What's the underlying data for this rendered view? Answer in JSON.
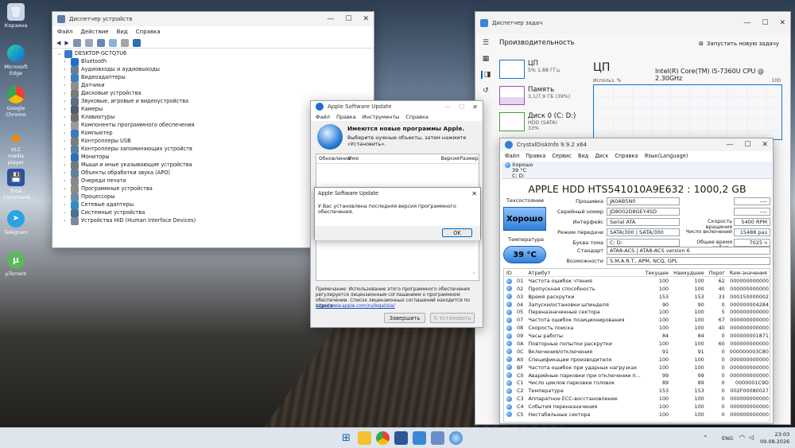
{
  "desktop_icons": [
    {
      "label": "Корзина",
      "icon": "recycle-bin-icon"
    },
    {
      "label": "Microsoft Edge",
      "icon": "edge-icon"
    },
    {
      "label": "Google Chrome",
      "icon": "chrome-icon"
    },
    {
      "label": "VLC media player",
      "icon": "vlc-icon"
    },
    {
      "label": "Total Command...",
      "icon": "total-commander-icon"
    },
    {
      "label": "Telegram",
      "icon": "telegram-icon"
    },
    {
      "label": "µTorrent",
      "icon": "utorrent-icon"
    }
  ],
  "device_manager": {
    "title": "Диспетчер устройств",
    "menu": [
      "Файл",
      "Действие",
      "Вид",
      "Справка"
    ],
    "root": "DESKTOP-GC7Q7U6",
    "items": [
      "Bluetooth",
      "Аудиовходы и аудиовыходы",
      "Видеоадаптеры",
      "Датчики",
      "Дисковые устройства",
      "Звуковые, игровые и видеоустройства",
      "Камеры",
      "Клавиатуры",
      "Компоненты программного обеспечения",
      "Компьютер",
      "Контроллеры USB",
      "Контроллеры запоминающих устройств",
      "Мониторы",
      "Мыши и иные указывающие устройства",
      "Объекты обработки звука (APO)",
      "Очереди печати",
      "Программные устройства",
      "Процессоры",
      "Сетевые адаптеры",
      "Системные устройства",
      "Устройства HID (Human Interface Devices)"
    ]
  },
  "task_manager": {
    "title": "Диспетчер задач",
    "header": "Производительность",
    "run_task": "Запустить новую задачу",
    "cards": [
      {
        "name": "ЦП",
        "detail": "5% 1,88 ГГц"
      },
      {
        "name": "Память",
        "detail": "3,1/7,9 ГБ (39%)"
      },
      {
        "name": "Диск 0 (C: D:)",
        "detail": "HDD (SATA)",
        "detail2": "33%"
      }
    ],
    "cpu_title": "ЦП",
    "cpu_model": "Intel(R) Core(TM) i5-7360U CPU @ 2.30GHz",
    "usage_label": "Использ. %",
    "usage_max": "100"
  },
  "apple_update": {
    "title": "Apple Software Update",
    "menu": [
      "Файл",
      "Правка",
      "Инструменты",
      "Справка"
    ],
    "heading": "Имеются новые программы Apple.",
    "subtext": "Выберите нужные объекты, затем нажмите «Установить».",
    "columns": [
      "Обновления",
      "Имя",
      "Версия",
      "Размер"
    ],
    "note": "Примечание: Использование этого программного обеспечения регулируется лицензионным соглашением о программном обеспечении. Список лицензионных соглашений находится по адресу:",
    "link": "http://www.apple.com/ru/legal/sla/",
    "finish_button": "Завершить",
    "install_button": "Установить",
    "dialog": {
      "title": "Apple Software Update",
      "message": "У Вас установлена последняя версия программного обеспечения.",
      "ok": "OK"
    }
  },
  "crystal": {
    "title": "CrystalDiskInfo 9.9.2 x64",
    "menu": [
      "Файл",
      "Правка",
      "Сервис",
      "Вид",
      "Диск",
      "Справка",
      "Язык(Language)"
    ],
    "tab_status": "Хорошо",
    "tab_temp": "39 °C",
    "tab_drive": "C: D:",
    "model": "APPLE HDD HTS541010A9E632 : 1000,2 GB",
    "health_label": "Техсостояние",
    "health_value": "Хорошо",
    "temp_label": "Температура",
    "temp_value": "39 °C",
    "fields_left": [
      {
        "label": "Прошивка",
        "value": "JA0AB5N0"
      },
      {
        "label": "Серийный номер",
        "value": "JD8002D8GEY4SD"
      },
      {
        "label": "Интерфейс",
        "value": "Serial ATA"
      },
      {
        "label": "Режим передачи",
        "value": "SATA/300 | SATA/300"
      },
      {
        "label": "Буква тома",
        "value": "C: D:"
      }
    ],
    "fields_right": [
      {
        "label": "",
        "value": "----"
      },
      {
        "label": "",
        "value": "----"
      },
      {
        "label": "Скорость вращения",
        "value": "5400 RPM"
      },
      {
        "label": "Число включений",
        "value": "15488 раз"
      },
      {
        "label": "Общее время работы",
        "value": "7025 ч"
      }
    ],
    "standard_label": "Стандарт",
    "standard_value": "ATA8-ACS | ATA8-ACS version 6",
    "features_label": "Возможности",
    "features_value": "S.M.A.R.T., APM, NCQ, GPL",
    "smart_headers": [
      "ID",
      "Атрибут",
      "Текущее",
      "Наихудшее",
      "Порог",
      "Raw-значения"
    ],
    "smart": [
      [
        "01",
        "Частота ошибок чтения",
        "100",
        "100",
        "62",
        "000000000000"
      ],
      [
        "02",
        "Пропускная способность",
        "100",
        "100",
        "40",
        "000000000000"
      ],
      [
        "03",
        "Время раскрутки",
        "153",
        "153",
        "33",
        "000150000002"
      ],
      [
        "04",
        "Запуски/остановки шпинделя",
        "90",
        "90",
        "0",
        "000000004284"
      ],
      [
        "05",
        "Переназначенные сектора",
        "100",
        "100",
        "5",
        "000000000000"
      ],
      [
        "07",
        "Частота ошибок позиционирования",
        "100",
        "100",
        "67",
        "000000000000"
      ],
      [
        "08",
        "Скорость поиска",
        "100",
        "100",
        "40",
        "000000000000"
      ],
      [
        "09",
        "Часы работы",
        "84",
        "84",
        "0",
        "000000001871"
      ],
      [
        "0A",
        "Повторные попытки раскрутки",
        "100",
        "100",
        "60",
        "000000000000"
      ],
      [
        "0C",
        "Включения/отключения",
        "91",
        "91",
        "0",
        "000000003C80"
      ],
      [
        "A0",
        "Спецификации производителя",
        "100",
        "100",
        "0",
        "000000000000"
      ],
      [
        "BF",
        "Частота ошибок при ударных нагрузках",
        "100",
        "100",
        "0",
        "000000000000"
      ],
      [
        "C0",
        "Аварийные парковки при отключении п...",
        "99",
        "99",
        "0",
        "000000000000"
      ],
      [
        "C1",
        "Число циклов парковки головок",
        "89",
        "89",
        "0",
        "0000001C9D"
      ],
      [
        "C2",
        "Температура",
        "153",
        "153",
        "0",
        "002F00080027"
      ],
      [
        "C3",
        "Аппаратное ECC-восстановление",
        "100",
        "100",
        "0",
        "000000000000"
      ],
      [
        "C4",
        "События переназначения",
        "100",
        "100",
        "0",
        "000000000000"
      ],
      [
        "C5",
        "Нестабильные сектора",
        "100",
        "100",
        "0",
        "000000000000"
      ]
    ]
  },
  "taskbar": {
    "lang": "ENG",
    "time": "23:03",
    "date": "09.08.2026"
  },
  "colors": {
    "accent": "#0067c0",
    "good": "#2f7fd8",
    "taskbar": "#dfe5ec"
  }
}
